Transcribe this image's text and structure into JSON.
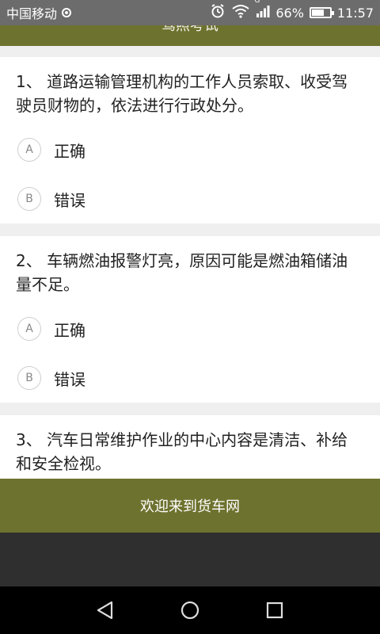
{
  "status": {
    "carrier": "中国移动",
    "network_type": "G",
    "battery": "66%",
    "battery_level": 0.66,
    "time": "11:57"
  },
  "header": {
    "title": "驾照考试"
  },
  "questions": [
    {
      "text": "1、 道路运输管理机构的工作人员索取、收受驾驶员财物的，依法进行行政处分。",
      "options": [
        {
          "letter": "A",
          "label": "正确"
        },
        {
          "letter": "B",
          "label": "错误"
        }
      ]
    },
    {
      "text": "2、 车辆燃油报警灯亮，原因可能是燃油箱储油量不足。",
      "options": [
        {
          "letter": "A",
          "label": "正确"
        },
        {
          "letter": "B",
          "label": "错误"
        }
      ]
    },
    {
      "text": "3、 汽车日常维护作业的中心内容是清洁、补给和安全检视。",
      "options": []
    }
  ],
  "footer": {
    "welcome": "欢迎来到货车网"
  },
  "icons": {
    "alarm": "alarm-clock-icon",
    "wifi": "wifi-icon",
    "signal": "signal-icon",
    "battery": "battery-icon",
    "back": "back-icon",
    "home": "home-icon",
    "recents": "recents-icon"
  },
  "colors": {
    "accent": "#6e722f",
    "status_bar": "#6c6c6c"
  }
}
